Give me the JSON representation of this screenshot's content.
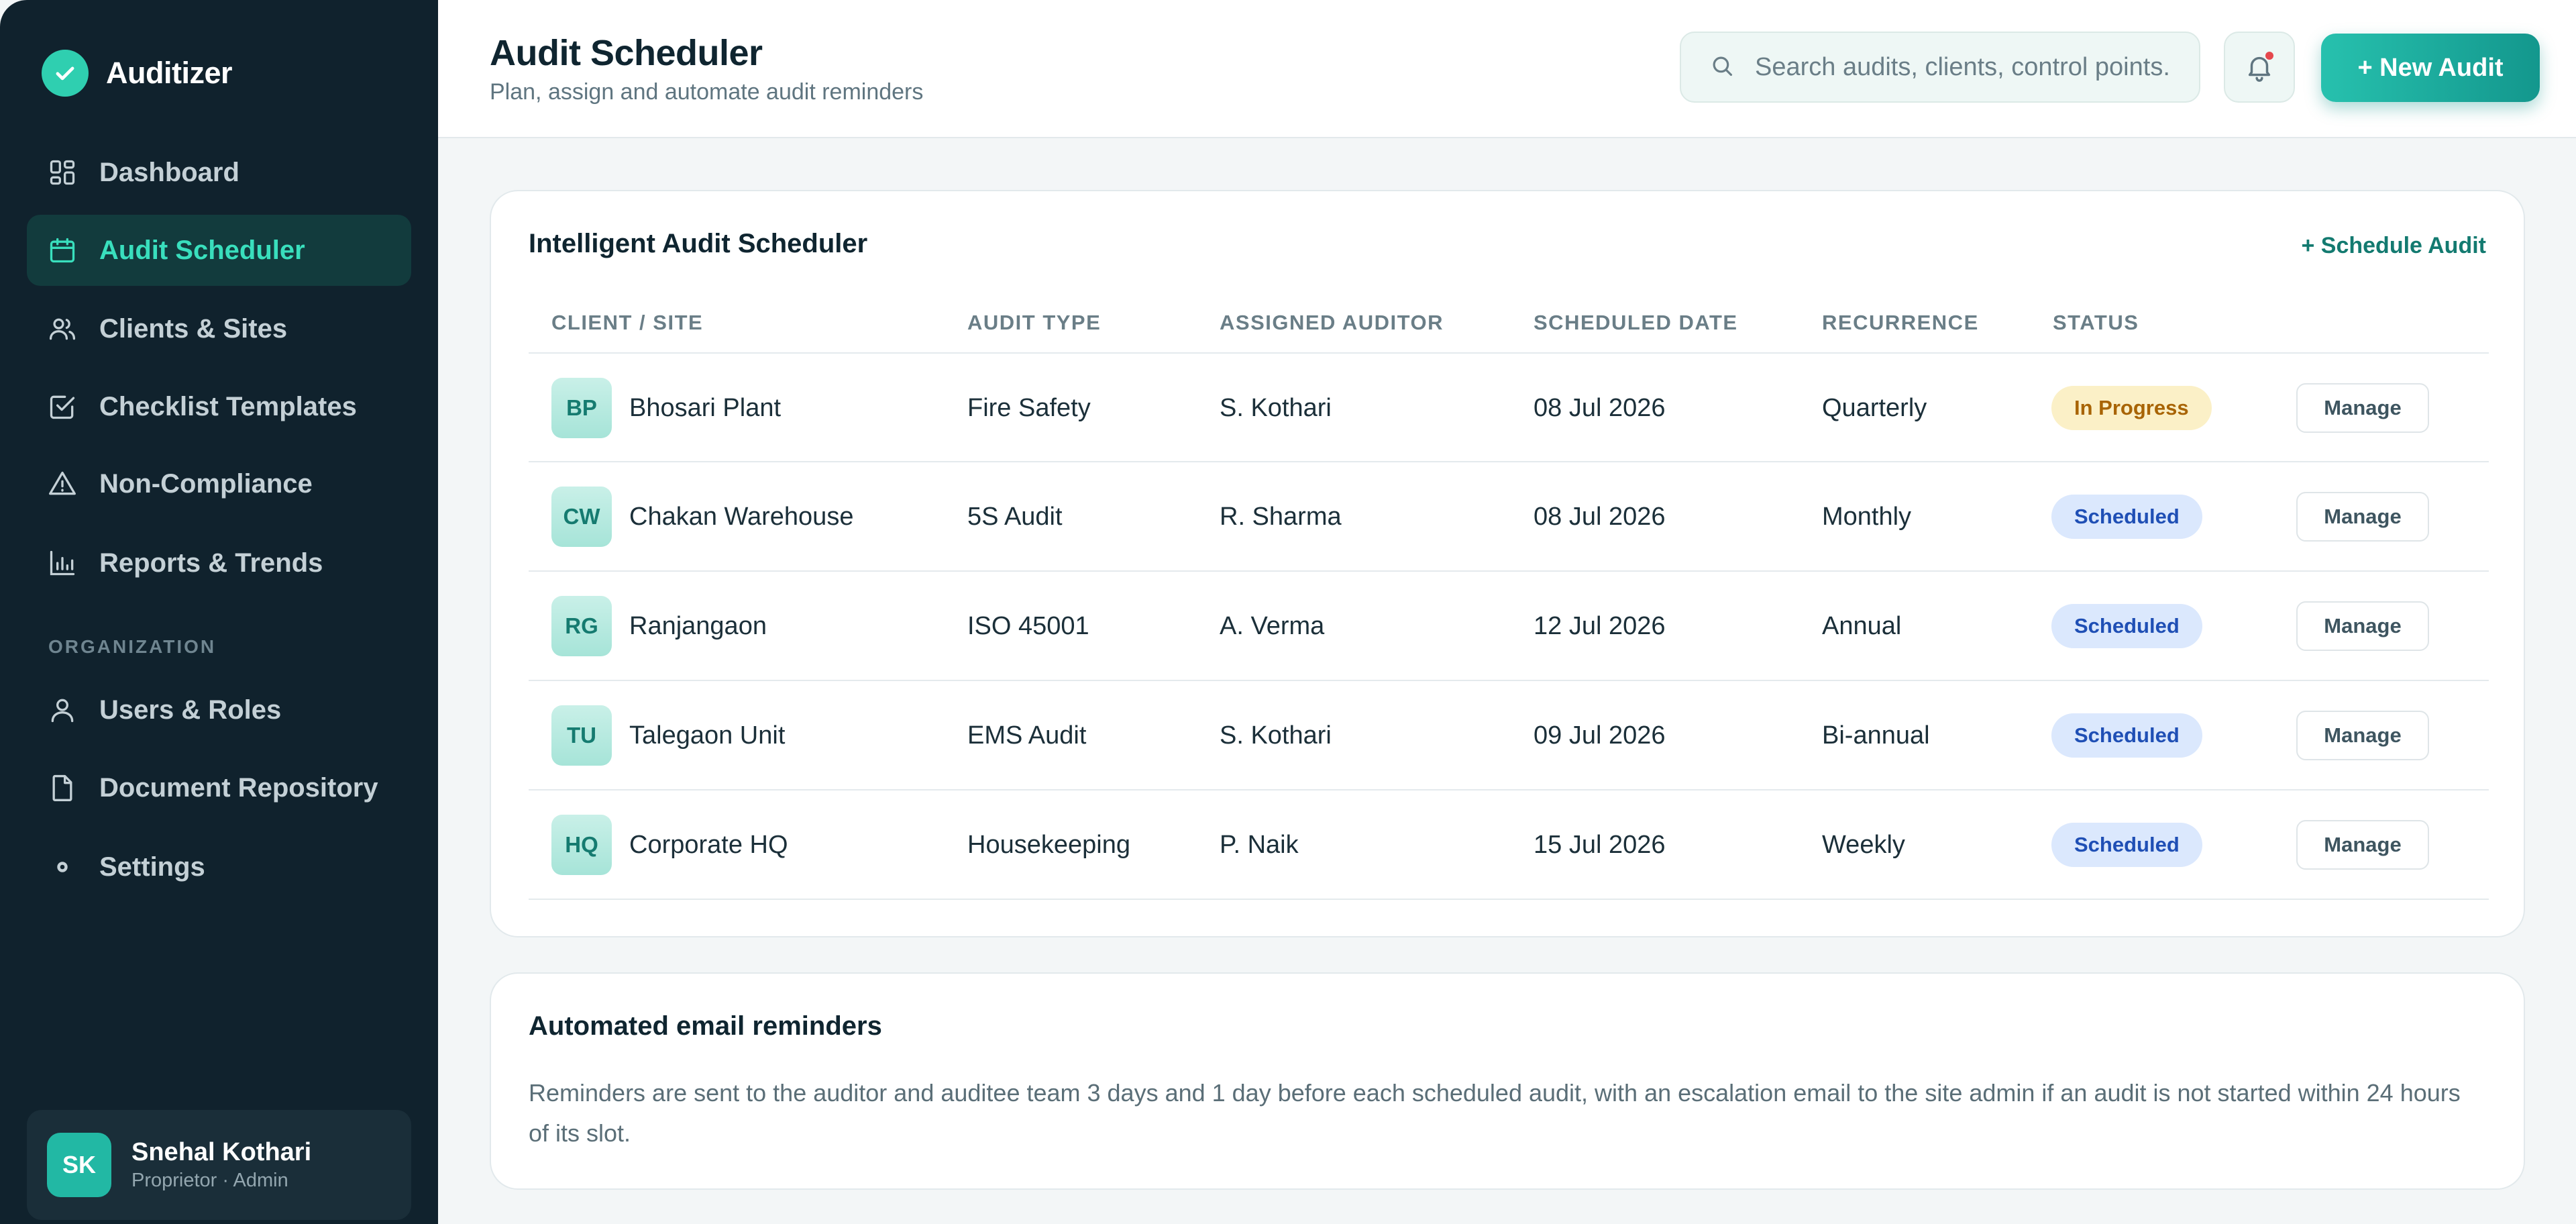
{
  "app": {
    "name": "Auditizer"
  },
  "sidebar": {
    "items": [
      {
        "label": "Dashboard",
        "icon": "dashboard-icon"
      },
      {
        "label": "Audit Scheduler",
        "icon": "calendar-icon",
        "active": true
      },
      {
        "label": "Clients & Sites",
        "icon": "users-icon"
      },
      {
        "label": "Checklist Templates",
        "icon": "checklist-icon"
      },
      {
        "label": "Non-Compliance",
        "icon": "warning-icon"
      },
      {
        "label": "Reports & Trends",
        "icon": "bar-chart-icon"
      }
    ],
    "section_label": "ORGANIZATION",
    "org_items": [
      {
        "label": "Users & Roles",
        "icon": "user-icon"
      },
      {
        "label": "Document Repository",
        "icon": "document-icon"
      },
      {
        "label": "Settings",
        "icon": "settings-icon"
      }
    ],
    "user": {
      "initials": "SK",
      "name": "Snehal Kothari",
      "role": "Proprietor · Admin"
    }
  },
  "header": {
    "title": "Audit Scheduler",
    "subtitle": "Plan, assign and automate audit reminders",
    "search_placeholder": "Search audits, clients, control points.",
    "new_button": "+ New Audit"
  },
  "scheduler": {
    "title": "Intelligent Audit Scheduler",
    "schedule_link": "+ Schedule Audit",
    "columns": [
      "CLIENT / SITE",
      "AUDIT TYPE",
      "ASSIGNED AUDITOR",
      "SCHEDULED DATE",
      "RECURRENCE",
      "STATUS"
    ],
    "rows": [
      {
        "initials": "BP",
        "site": "Bhosari Plant",
        "type": "Fire Safety",
        "auditor": "S. Kothari",
        "date": "08 Jul 2026",
        "recurrence": "Quarterly",
        "status": "In Progress",
        "action": "Manage"
      },
      {
        "initials": "CW",
        "site": "Chakan Warehouse",
        "type": "5S Audit",
        "auditor": "R. Sharma",
        "date": "08 Jul 2026",
        "recurrence": "Monthly",
        "status": "Scheduled",
        "action": "Manage"
      },
      {
        "initials": "RG",
        "site": "Ranjangaon",
        "type": "ISO 45001",
        "auditor": "A. Verma",
        "date": "12 Jul 2026",
        "recurrence": "Annual",
        "status": "Scheduled",
        "action": "Manage"
      },
      {
        "initials": "TU",
        "site": "Talegaon Unit",
        "type": "EMS Audit",
        "auditor": "S. Kothari",
        "date": "09 Jul 2026",
        "recurrence": "Bi-annual",
        "status": "Scheduled",
        "action": "Manage"
      },
      {
        "initials": "HQ",
        "site": "Corporate HQ",
        "type": "Housekeeping",
        "auditor": "P. Naik",
        "date": "15 Jul 2026",
        "recurrence": "Weekly",
        "status": "Scheduled",
        "action": "Manage"
      }
    ]
  },
  "reminders": {
    "title": "Automated email reminders",
    "text": "Reminders are sent to the auditor and auditee team 3 days and 1 day before each scheduled audit, with an escalation email to the site admin if an audit is not started within 24 hours of its slot."
  },
  "colors": {
    "sidebar_bg": "#10222d",
    "accent": "#39dfbd",
    "primary_button": "#1aa89b",
    "status_progress": "#fbf0c7",
    "status_scheduled": "#dbe8fd"
  }
}
